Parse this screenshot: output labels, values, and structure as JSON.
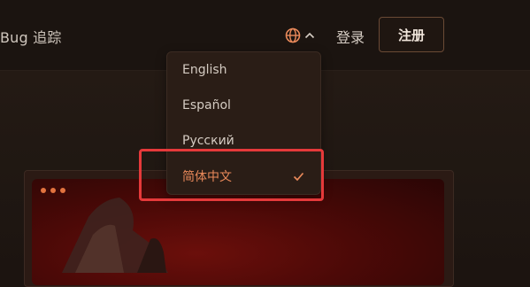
{
  "header": {
    "brand": "Bug 追踪",
    "login": "登录",
    "register": "注册",
    "language_icon": "globe-icon",
    "chevron_icon": "chevron-up-icon",
    "accent_color": "#e9895a"
  },
  "language_menu": {
    "items": [
      {
        "label": "English",
        "selected": false
      },
      {
        "label": "Español",
        "selected": false
      },
      {
        "label": "Русский",
        "selected": false
      },
      {
        "label": "简体中文",
        "selected": true
      }
    ],
    "check_icon": "check-icon"
  }
}
